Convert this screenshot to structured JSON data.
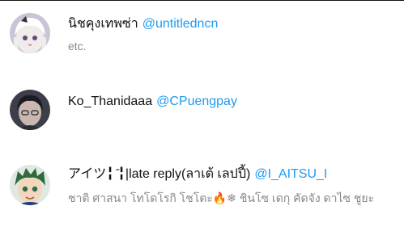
{
  "users": [
    {
      "display_name": "นิชคุงเทพซ่า",
      "handle": "@untitledncn",
      "bio": "etc."
    },
    {
      "display_name": "Ko_Thanidaaa",
      "handle": "@CPuengpay",
      "bio": ""
    },
    {
      "display_name": "アイツ╏ ̄╏|late reply(ลาเต้ เลปปี้)",
      "handle": "@I_AITSU_I",
      "bio": "ชาติ ศาสนา โทโดโรกิ โชโตะ🔥❄ ชินโซ เดกุ คัดจัง ดาไซ ชูยะ"
    }
  ]
}
